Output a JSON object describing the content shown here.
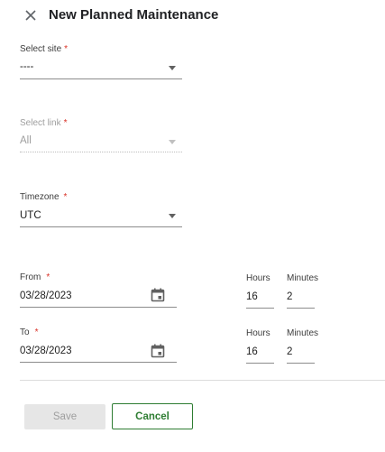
{
  "dialog": {
    "title": "New Planned Maintenance",
    "close_icon": "close-icon"
  },
  "site": {
    "label": "Select site",
    "required_mark": "*",
    "value": "----"
  },
  "link": {
    "label": "Select link",
    "required_mark": "*",
    "value": "All",
    "disabled": true
  },
  "timezone": {
    "label": "Timezone",
    "required_mark": "*",
    "value": "UTC"
  },
  "from": {
    "label": "From",
    "required_mark": "*",
    "date": "03/28/2023",
    "hours_label": "Hours",
    "hours": "16",
    "minutes_label": "Minutes",
    "minutes": "2",
    "icon": "calendar-icon"
  },
  "to": {
    "label": "To",
    "required_mark": "*",
    "date": "03/28/2023",
    "hours_label": "Hours",
    "hours": "16",
    "minutes_label": "Minutes",
    "minutes": "2",
    "icon": "calendar-icon"
  },
  "actions": {
    "save_label": "Save",
    "cancel_label": "Cancel",
    "save_disabled": true
  },
  "colors": {
    "accent": "#2e7d32",
    "required": "#d93025",
    "disabled_text": "#9e9e9e"
  }
}
